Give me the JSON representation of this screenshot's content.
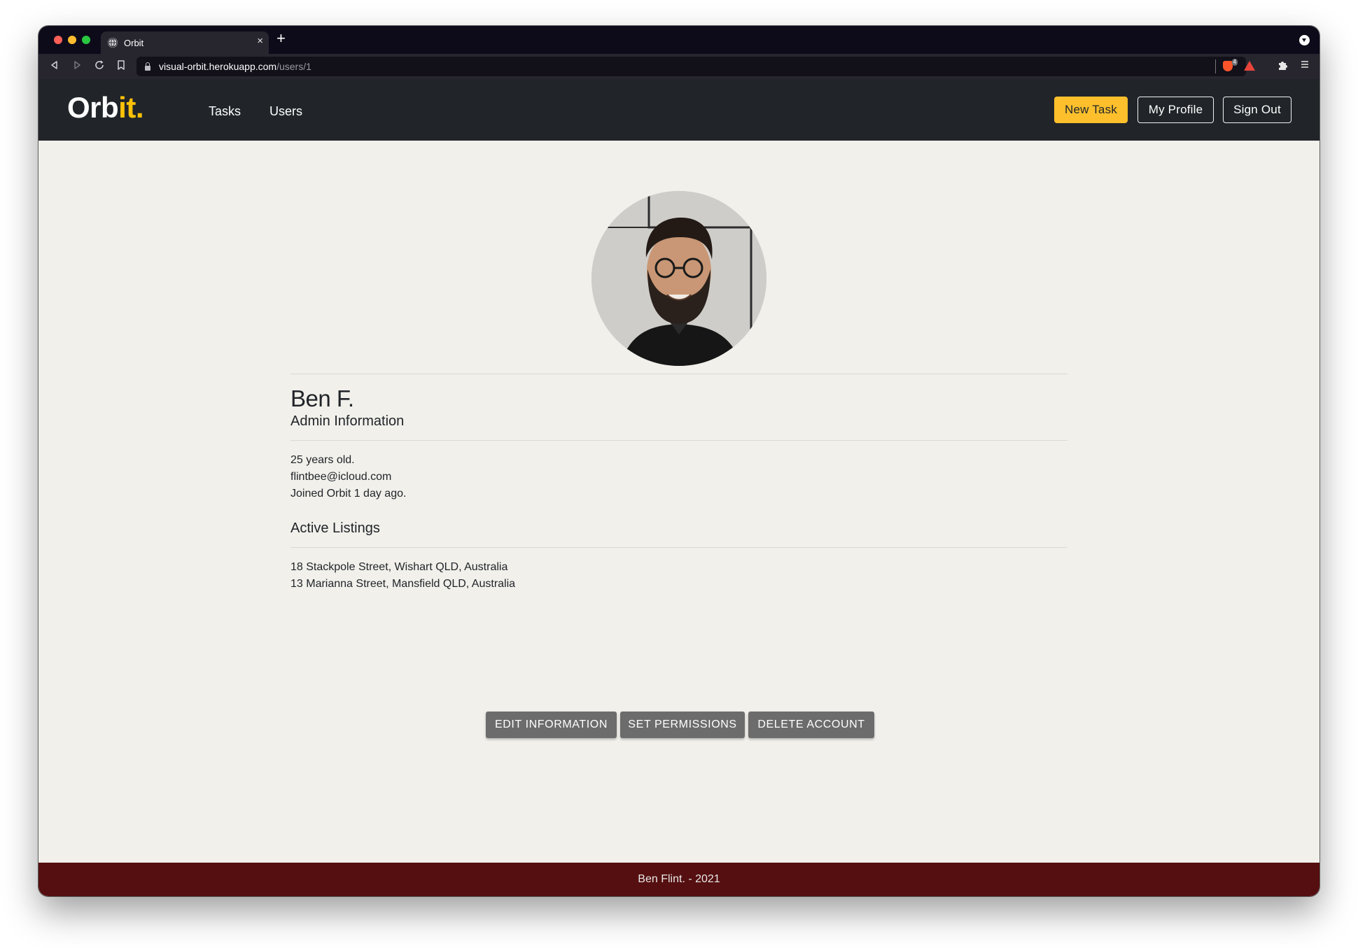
{
  "browser": {
    "tab_title": "Orbit",
    "tab_close": "×",
    "new_tab": "+",
    "url_host": "visual-orbit.herokuapp.com",
    "url_path": "/users/1",
    "shields_count": "4",
    "icons": [
      "back-icon",
      "forward-icon",
      "reload-icon",
      "bookmark-icon",
      "lock-icon",
      "brave-shields-icon",
      "brave-rewards-icon",
      "extensions-icon",
      "menu-icon"
    ]
  },
  "navbar": {
    "brand_main": "Orb",
    "brand_accent": "it",
    "brand_dot": ".",
    "links": [
      "Tasks",
      "Users"
    ],
    "new_task": "New Task",
    "my_profile": "My Profile",
    "sign_out": "Sign Out"
  },
  "profile": {
    "name": "Ben F.",
    "info_heading": "Admin Information",
    "age": "25 years old.",
    "email": "flintbee@icloud.com",
    "joined": "Joined Orbit 1 day ago.",
    "listings_heading": "Active Listings",
    "listings": [
      "18 Stackpole Street, Wishart QLD, Australia",
      "13 Marianna Street, Mansfield QLD, Australia"
    ]
  },
  "actions": {
    "edit": "EDIT INFORMATION",
    "permissions": "SET PERMISSIONS",
    "delete": "DELETE ACCOUNT"
  },
  "footer": {
    "text": "Ben Flint. - 2021"
  },
  "colors": {
    "accent": "#ffc107",
    "navbar_bg": "#212529",
    "page_bg": "#f1f0eb",
    "footer_bg": "#550f10",
    "action_button_bg": "#6c6c6c"
  }
}
